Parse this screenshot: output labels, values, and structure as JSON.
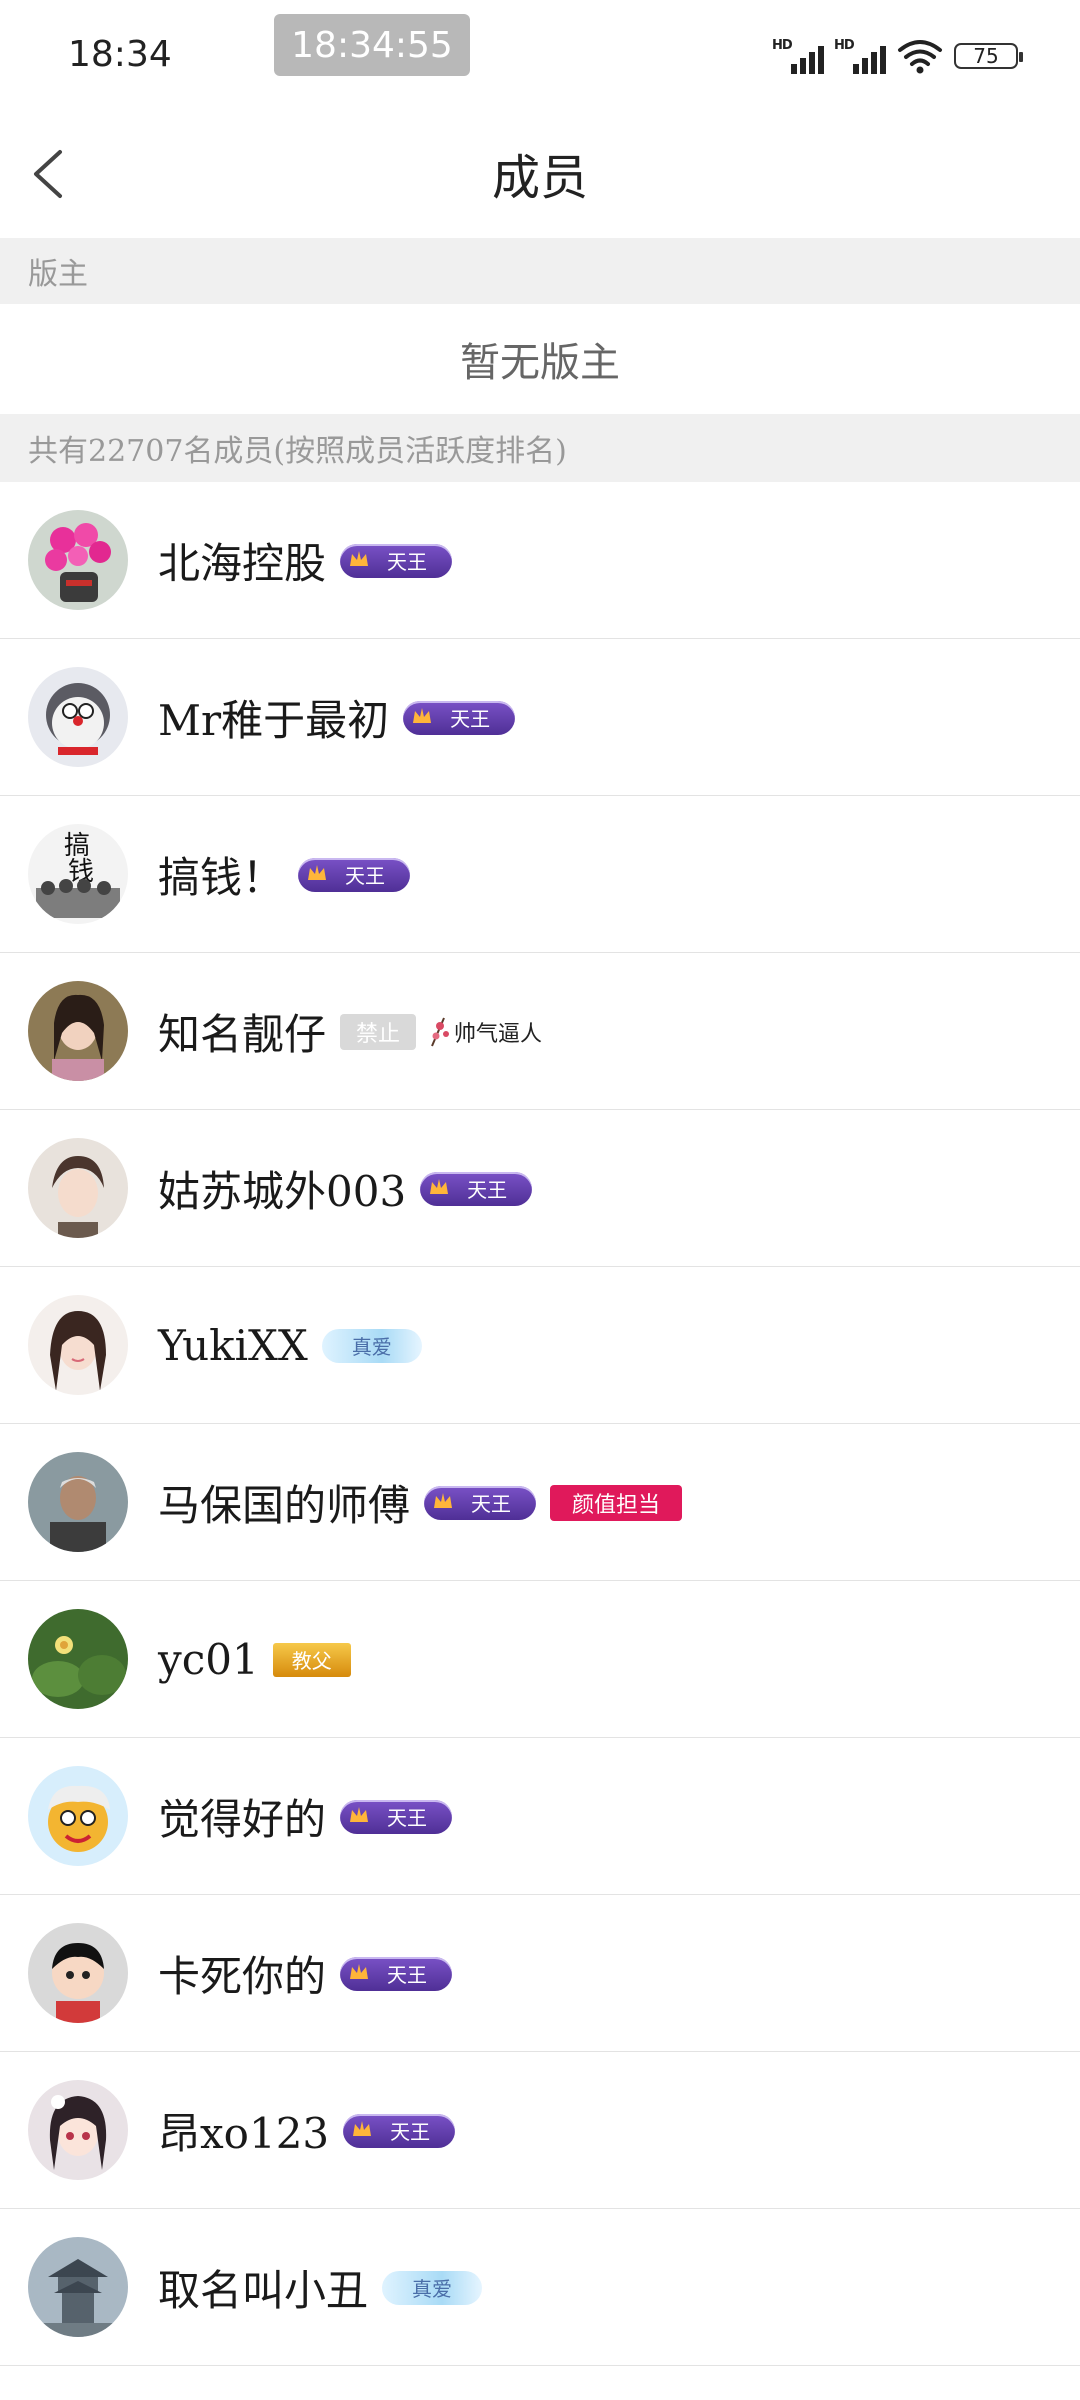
{
  "status_bar": {
    "time": "18:34",
    "clock_pill": "18:34:55",
    "network_1": "HD",
    "network_2": "HD",
    "battery": "75"
  },
  "header": {
    "title": "成员",
    "back_icon": "chevron-left-icon"
  },
  "moderator_section": {
    "label": "版主",
    "empty_text": "暂无版主"
  },
  "members_section": {
    "label": "共有22707名成员(按照成员活跃度排名)"
  },
  "members": [
    {
      "name": "北海控股",
      "badges": [
        {
          "type": "tianwang",
          "text": "天王"
        }
      ]
    },
    {
      "name": "Mr稚于最初",
      "badges": [
        {
          "type": "tianwang",
          "text": "天王"
        }
      ]
    },
    {
      "name": "搞钱！",
      "badges": [
        {
          "type": "tianwang",
          "text": "天王"
        }
      ]
    },
    {
      "name": "知名靓仔",
      "badges": [
        {
          "type": "banned",
          "text": "禁止"
        },
        {
          "type": "shuaiqi",
          "text": "帅气逼人"
        }
      ]
    },
    {
      "name": "姑苏城外003",
      "badges": [
        {
          "type": "tianwang",
          "text": "天王"
        }
      ]
    },
    {
      "name": "YukiXX",
      "badges": [
        {
          "type": "zhenai",
          "text": "真爱"
        }
      ]
    },
    {
      "name": "马保国的师傅",
      "badges": [
        {
          "type": "tianwang",
          "text": "天王"
        },
        {
          "type": "yanzhi",
          "text": "颜值担当"
        }
      ]
    },
    {
      "name": "yc01",
      "badges": [
        {
          "type": "jiaowen",
          "text": "教父"
        }
      ]
    },
    {
      "name": "觉得好的",
      "badges": [
        {
          "type": "tianwang",
          "text": "天王"
        }
      ]
    },
    {
      "name": "卡死你的",
      "badges": [
        {
          "type": "tianwang",
          "text": "天王"
        }
      ]
    },
    {
      "name": "昂xo123",
      "badges": [
        {
          "type": "tianwang",
          "text": "天王"
        }
      ]
    },
    {
      "name": "取名叫小丑",
      "badges": [
        {
          "type": "zhenai",
          "text": "真爱"
        }
      ]
    }
  ],
  "colors": {
    "section_bg": "#f0f0f0",
    "tianwang_badge": "#5b36a8",
    "yanzhi_badge": "#e0195b",
    "divider": "#e3e3e3"
  }
}
